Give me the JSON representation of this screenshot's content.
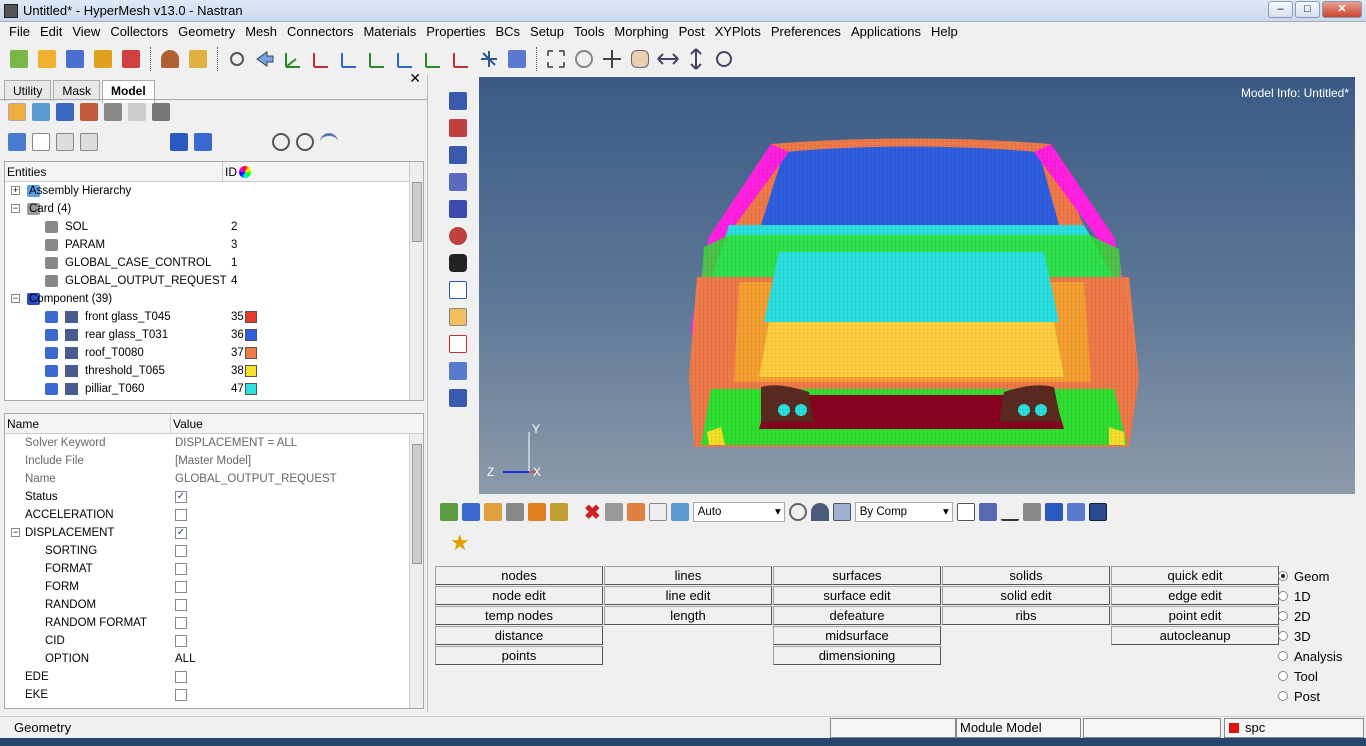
{
  "window": {
    "title": "Untitled* - HyperMesh v13.0 - Nastran",
    "min": "–",
    "max": "□",
    "close": "✕"
  },
  "menu": [
    "File",
    "Edit",
    "View",
    "Collectors",
    "Geometry",
    "Mesh",
    "Connectors",
    "Materials",
    "Properties",
    "BCs",
    "Setup",
    "Tools",
    "Morphing",
    "Post",
    "XYPlots",
    "Preferences",
    "Applications",
    "Help"
  ],
  "left_panel": {
    "tabs": [
      "Utility",
      "Mask",
      "Model"
    ],
    "active_tab": "Model",
    "close": "✕",
    "entities_header": {
      "name": "Entities",
      "id": "ID"
    },
    "tree": [
      {
        "label": "Assembly Hierarchy",
        "level": 0,
        "exp": "+",
        "kind": "asm"
      },
      {
        "label": "Card (4)",
        "level": 0,
        "exp": "−",
        "kind": "folder"
      },
      {
        "label": "SOL",
        "level": 1,
        "id": "2",
        "kind": "card"
      },
      {
        "label": "PARAM",
        "level": 1,
        "id": "3",
        "kind": "card"
      },
      {
        "label": "GLOBAL_CASE_CONTROL",
        "level": 1,
        "id": "1",
        "kind": "card"
      },
      {
        "label": "GLOBAL_OUTPUT_REQUEST",
        "level": 1,
        "id": "4",
        "kind": "card"
      },
      {
        "label": "Component (39)",
        "level": 0,
        "exp": "−",
        "kind": "comp-folder"
      },
      {
        "label": "front glass_T045",
        "level": 2,
        "id": "35",
        "color": "#e8382a",
        "kind": "comp"
      },
      {
        "label": "rear glass_T031",
        "level": 2,
        "id": "36",
        "color": "#2f5fe0",
        "kind": "comp"
      },
      {
        "label": "roof_T0080",
        "level": 2,
        "id": "37",
        "color": "#f07a4a",
        "kind": "comp"
      },
      {
        "label": "threshold_T065",
        "level": 2,
        "id": "38",
        "color": "#f5e12a",
        "kind": "comp"
      },
      {
        "label": "pilliar_T060",
        "level": 2,
        "id": "47",
        "color": "#2ae0e0",
        "kind": "comp"
      }
    ],
    "props_header": {
      "name": "Name",
      "value": "Value"
    },
    "props": [
      {
        "name": "Solver Keyword",
        "value": "DISPLACEMENT = ALL",
        "indent": 1,
        "grey": true
      },
      {
        "name": "Include File",
        "value": "[Master Model]",
        "indent": 1,
        "grey": true
      },
      {
        "name": "Name",
        "value": "GLOBAL_OUTPUT_REQUEST",
        "indent": 1,
        "grey": true
      },
      {
        "name": "Status",
        "check": true,
        "indent": 1
      },
      {
        "name": "ACCELERATION",
        "check": false,
        "indent": 1
      },
      {
        "name": "DISPLACEMENT",
        "check": true,
        "indent": 1,
        "exp": "−"
      },
      {
        "name": "SORTING",
        "check": false,
        "indent": 2
      },
      {
        "name": "FORMAT",
        "check": false,
        "indent": 2
      },
      {
        "name": "FORM",
        "check": false,
        "indent": 2
      },
      {
        "name": "RANDOM",
        "check": false,
        "indent": 2
      },
      {
        "name": "RANDOM FORMAT",
        "check": false,
        "indent": 2
      },
      {
        "name": "CID",
        "check": false,
        "indent": 2
      },
      {
        "name": "OPTION",
        "value": "ALL",
        "indent": 2
      },
      {
        "name": "EDE",
        "check": false,
        "indent": 1
      },
      {
        "name": "EKE",
        "check": false,
        "indent": 1
      }
    ]
  },
  "viewport": {
    "model_info": "Model Info: Untitled*",
    "axis_y": "Y",
    "axis_z": "Z",
    "axis_x": "X"
  },
  "lower_toolbar": {
    "vis_mode": "Auto",
    "color_mode": "By Comp"
  },
  "panel_buttons": [
    [
      "nodes",
      "lines",
      "surfaces",
      "solids",
      "quick edit"
    ],
    [
      "node edit",
      "line edit",
      "surface edit",
      "solid edit",
      "edge edit"
    ],
    [
      "temp nodes",
      "length",
      "defeature",
      "ribs",
      "point edit"
    ],
    [
      "distance",
      "",
      "midsurface",
      "",
      "autocleanup"
    ],
    [
      "points",
      "",
      "dimensioning",
      "",
      ""
    ]
  ],
  "page_radios": [
    "Geom",
    "1D",
    "2D",
    "3D",
    "Analysis",
    "Tool",
    "Post"
  ],
  "page_selected": "Geom",
  "status": {
    "left": "Geometry",
    "module": "Module Model",
    "collector": "spc",
    "collector_color": "#e01010"
  }
}
